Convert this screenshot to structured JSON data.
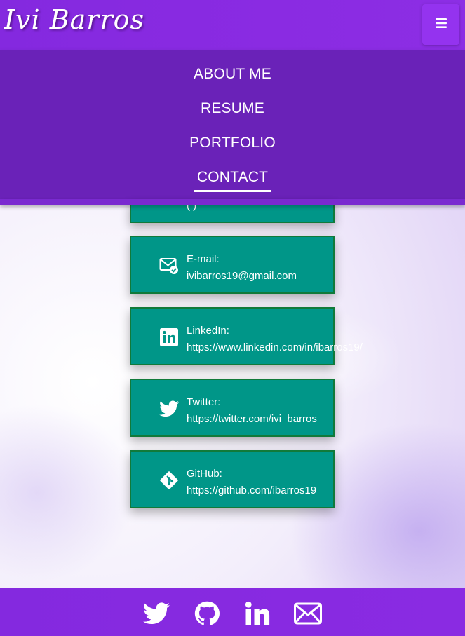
{
  "brand": "Ivi Barros",
  "nav": {
    "items": [
      {
        "label": "ABOUT ME"
      },
      {
        "label": "RESUME"
      },
      {
        "label": "PORTFOLIO"
      },
      {
        "label": "CONTACT",
        "active": true
      }
    ]
  },
  "contacts": {
    "phone": {
      "label": "",
      "value": "(  )"
    },
    "email": {
      "label": "E-mail:",
      "value": "ivibarros19@gmail.com",
      "icon": "email-check-icon"
    },
    "linkedin": {
      "label": "LinkedIn:",
      "value": "https://www.linkedin.com/in/ibarros19/",
      "icon": "linkedin-icon"
    },
    "twitter": {
      "label": "Twitter:",
      "value": "https://twitter.com/ivi_barros",
      "icon": "twitter-icon"
    },
    "github": {
      "label": "GitHub:",
      "value": "https://github.com/ibarros19",
      "icon": "git-icon"
    }
  },
  "footer": {
    "icons": [
      "twitter-icon",
      "github-icon",
      "linkedin-icon",
      "envelope-icon"
    ]
  },
  "colors": {
    "header": "#8a2be2",
    "nav": "#6a22b8",
    "card": "#009688",
    "card_border": "#117a3a"
  }
}
